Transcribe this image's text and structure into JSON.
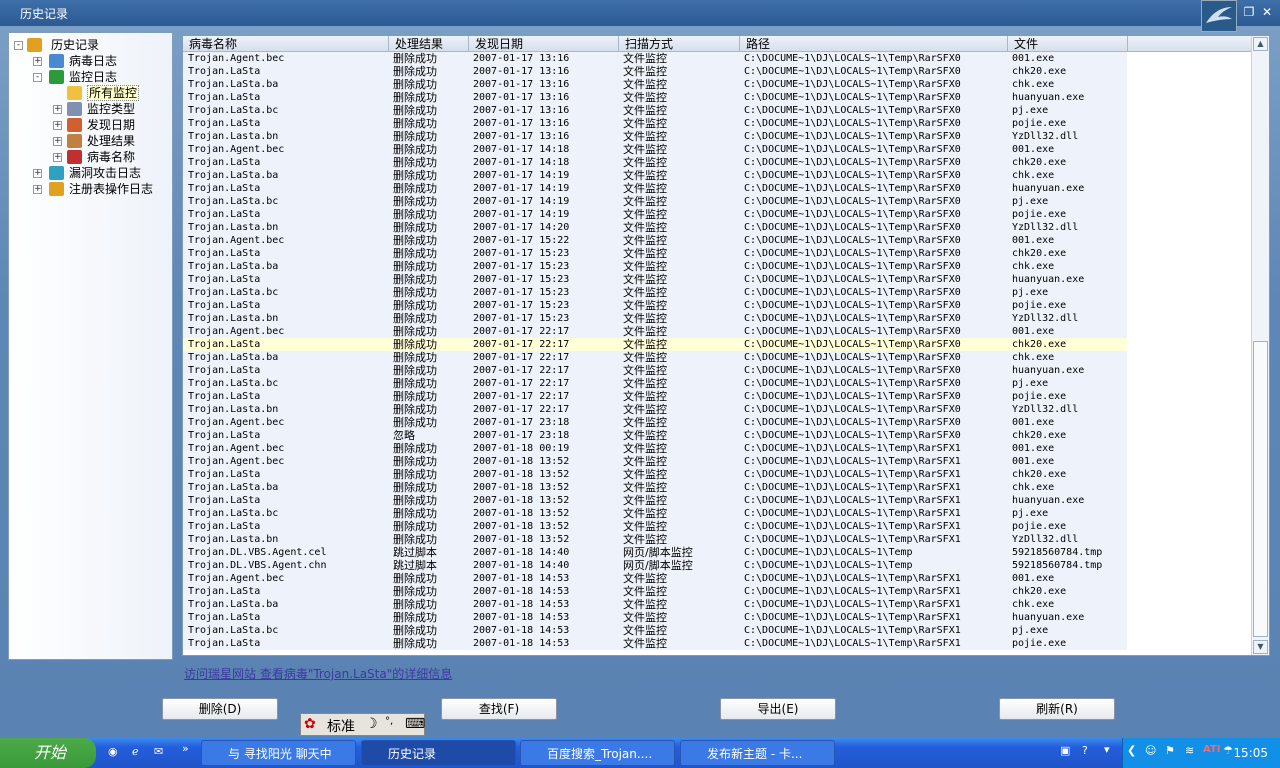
{
  "window": {
    "title": "历史记录"
  },
  "tree": [
    {
      "label": "历史记录",
      "expand": "-",
      "icon": "history-icon"
    },
    {
      "label": "病毒日志",
      "expand": "+",
      "icon": "virus-log-icon"
    },
    {
      "label": "监控日志",
      "expand": "-",
      "icon": "monitor-log-icon"
    },
    {
      "label": "所有监控",
      "expand": "",
      "icon": "all-monitor-icon",
      "selected": true
    },
    {
      "label": "监控类型",
      "expand": "+",
      "icon": "monitor-type-icon"
    },
    {
      "label": "发现日期",
      "expand": "+",
      "icon": "date-icon"
    },
    {
      "label": "处理结果",
      "expand": "+",
      "icon": "result-icon"
    },
    {
      "label": "病毒名称",
      "expand": "+",
      "icon": "virus-name-icon"
    },
    {
      "label": "漏洞攻击日志",
      "expand": "+",
      "icon": "exploit-log-icon"
    },
    {
      "label": "注册表操作日志",
      "expand": "+",
      "icon": "registry-log-icon"
    }
  ],
  "columns": [
    "病毒名称",
    "处理结果",
    "发现日期",
    "扫描方式",
    "路径",
    "文件"
  ],
  "rows": [
    [
      "Trojan.Agent.bec",
      "删除成功",
      "2007-01-17 13:16",
      "文件监控",
      "C:\\DOCUME~1\\DJ\\LOCALS~1\\Temp\\RarSFX0",
      "001.exe"
    ],
    [
      "Trojan.LaSta",
      "删除成功",
      "2007-01-17 13:16",
      "文件监控",
      "C:\\DOCUME~1\\DJ\\LOCALS~1\\Temp\\RarSFX0",
      "chk20.exe"
    ],
    [
      "Trojan.LaSta.ba",
      "删除成功",
      "2007-01-17 13:16",
      "文件监控",
      "C:\\DOCUME~1\\DJ\\LOCALS~1\\Temp\\RarSFX0",
      "chk.exe"
    ],
    [
      "Trojan.LaSta",
      "删除成功",
      "2007-01-17 13:16",
      "文件监控",
      "C:\\DOCUME~1\\DJ\\LOCALS~1\\Temp\\RarSFX0",
      "huanyuan.exe"
    ],
    [
      "Trojan.LaSta.bc",
      "删除成功",
      "2007-01-17 13:16",
      "文件监控",
      "C:\\DOCUME~1\\DJ\\LOCALS~1\\Temp\\RarSFX0",
      "pj.exe"
    ],
    [
      "Trojan.LaSta",
      "删除成功",
      "2007-01-17 13:16",
      "文件监控",
      "C:\\DOCUME~1\\DJ\\LOCALS~1\\Temp\\RarSFX0",
      "pojie.exe"
    ],
    [
      "Trojan.Lasta.bn",
      "删除成功",
      "2007-01-17 13:16",
      "文件监控",
      "C:\\DOCUME~1\\DJ\\LOCALS~1\\Temp\\RarSFX0",
      "YzDll32.dll"
    ],
    [
      "Trojan.Agent.bec",
      "删除成功",
      "2007-01-17 14:18",
      "文件监控",
      "C:\\DOCUME~1\\DJ\\LOCALS~1\\Temp\\RarSFX0",
      "001.exe"
    ],
    [
      "Trojan.LaSta",
      "删除成功",
      "2007-01-17 14:18",
      "文件监控",
      "C:\\DOCUME~1\\DJ\\LOCALS~1\\Temp\\RarSFX0",
      "chk20.exe"
    ],
    [
      "Trojan.LaSta.ba",
      "删除成功",
      "2007-01-17 14:19",
      "文件监控",
      "C:\\DOCUME~1\\DJ\\LOCALS~1\\Temp\\RarSFX0",
      "chk.exe"
    ],
    [
      "Trojan.LaSta",
      "删除成功",
      "2007-01-17 14:19",
      "文件监控",
      "C:\\DOCUME~1\\DJ\\LOCALS~1\\Temp\\RarSFX0",
      "huanyuan.exe"
    ],
    [
      "Trojan.LaSta.bc",
      "删除成功",
      "2007-01-17 14:19",
      "文件监控",
      "C:\\DOCUME~1\\DJ\\LOCALS~1\\Temp\\RarSFX0",
      "pj.exe"
    ],
    [
      "Trojan.LaSta",
      "删除成功",
      "2007-01-17 14:19",
      "文件监控",
      "C:\\DOCUME~1\\DJ\\LOCALS~1\\Temp\\RarSFX0",
      "pojie.exe"
    ],
    [
      "Trojan.Lasta.bn",
      "删除成功",
      "2007-01-17 14:20",
      "文件监控",
      "C:\\DOCUME~1\\DJ\\LOCALS~1\\Temp\\RarSFX0",
      "YzDll32.dll"
    ],
    [
      "Trojan.Agent.bec",
      "删除成功",
      "2007-01-17 15:22",
      "文件监控",
      "C:\\DOCUME~1\\DJ\\LOCALS~1\\Temp\\RarSFX0",
      "001.exe"
    ],
    [
      "Trojan.LaSta",
      "删除成功",
      "2007-01-17 15:23",
      "文件监控",
      "C:\\DOCUME~1\\DJ\\LOCALS~1\\Temp\\RarSFX0",
      "chk20.exe"
    ],
    [
      "Trojan.LaSta.ba",
      "删除成功",
      "2007-01-17 15:23",
      "文件监控",
      "C:\\DOCUME~1\\DJ\\LOCALS~1\\Temp\\RarSFX0",
      "chk.exe"
    ],
    [
      "Trojan.LaSta",
      "删除成功",
      "2007-01-17 15:23",
      "文件监控",
      "C:\\DOCUME~1\\DJ\\LOCALS~1\\Temp\\RarSFX0",
      "huanyuan.exe"
    ],
    [
      "Trojan.LaSta.bc",
      "删除成功",
      "2007-01-17 15:23",
      "文件监控",
      "C:\\DOCUME~1\\DJ\\LOCALS~1\\Temp\\RarSFX0",
      "pj.exe"
    ],
    [
      "Trojan.LaSta",
      "删除成功",
      "2007-01-17 15:23",
      "文件监控",
      "C:\\DOCUME~1\\DJ\\LOCALS~1\\Temp\\RarSFX0",
      "pojie.exe"
    ],
    [
      "Trojan.Lasta.bn",
      "删除成功",
      "2007-01-17 15:23",
      "文件监控",
      "C:\\DOCUME~1\\DJ\\LOCALS~1\\Temp\\RarSFX0",
      "YzDll32.dll"
    ],
    [
      "Trojan.Agent.bec",
      "删除成功",
      "2007-01-17 22:17",
      "文件监控",
      "C:\\DOCUME~1\\DJ\\LOCALS~1\\Temp\\RarSFX0",
      "001.exe"
    ],
    [
      "Trojan.LaSta",
      "删除成功",
      "2007-01-17 22:17",
      "文件监控",
      "C:\\DOCUME~1\\DJ\\LOCALS~1\\Temp\\RarSFX0",
      "chk20.exe"
    ],
    [
      "Trojan.LaSta.ba",
      "删除成功",
      "2007-01-17 22:17",
      "文件监控",
      "C:\\DOCUME~1\\DJ\\LOCALS~1\\Temp\\RarSFX0",
      "chk.exe"
    ],
    [
      "Trojan.LaSta",
      "删除成功",
      "2007-01-17 22:17",
      "文件监控",
      "C:\\DOCUME~1\\DJ\\LOCALS~1\\Temp\\RarSFX0",
      "huanyuan.exe"
    ],
    [
      "Trojan.LaSta.bc",
      "删除成功",
      "2007-01-17 22:17",
      "文件监控",
      "C:\\DOCUME~1\\DJ\\LOCALS~1\\Temp\\RarSFX0",
      "pj.exe"
    ],
    [
      "Trojan.LaSta",
      "删除成功",
      "2007-01-17 22:17",
      "文件监控",
      "C:\\DOCUME~1\\DJ\\LOCALS~1\\Temp\\RarSFX0",
      "pojie.exe"
    ],
    [
      "Trojan.Lasta.bn",
      "删除成功",
      "2007-01-17 22:17",
      "文件监控",
      "C:\\DOCUME~1\\DJ\\LOCALS~1\\Temp\\RarSFX0",
      "YzDll32.dll"
    ],
    [
      "Trojan.Agent.bec",
      "删除成功",
      "2007-01-17 23:18",
      "文件监控",
      "C:\\DOCUME~1\\DJ\\LOCALS~1\\Temp\\RarSFX0",
      "001.exe"
    ],
    [
      "Trojan.LaSta",
      "忽略",
      "2007-01-17 23:18",
      "文件监控",
      "C:\\DOCUME~1\\DJ\\LOCALS~1\\Temp\\RarSFX0",
      "chk20.exe"
    ],
    [
      "Trojan.Agent.bec",
      "删除成功",
      "2007-01-18 00:19",
      "文件监控",
      "C:\\DOCUME~1\\DJ\\LOCALS~1\\Temp\\RarSFX1",
      "001.exe"
    ],
    [
      "Trojan.Agent.bec",
      "删除成功",
      "2007-01-18 13:52",
      "文件监控",
      "C:\\DOCUME~1\\DJ\\LOCALS~1\\Temp\\RarSFX1",
      "001.exe"
    ],
    [
      "Trojan.LaSta",
      "删除成功",
      "2007-01-18 13:52",
      "文件监控",
      "C:\\DOCUME~1\\DJ\\LOCALS~1\\Temp\\RarSFX1",
      "chk20.exe"
    ],
    [
      "Trojan.LaSta.ba",
      "删除成功",
      "2007-01-18 13:52",
      "文件监控",
      "C:\\DOCUME~1\\DJ\\LOCALS~1\\Temp\\RarSFX1",
      "chk.exe"
    ],
    [
      "Trojan.LaSta",
      "删除成功",
      "2007-01-18 13:52",
      "文件监控",
      "C:\\DOCUME~1\\DJ\\LOCALS~1\\Temp\\RarSFX1",
      "huanyuan.exe"
    ],
    [
      "Trojan.LaSta.bc",
      "删除成功",
      "2007-01-18 13:52",
      "文件监控",
      "C:\\DOCUME~1\\DJ\\LOCALS~1\\Temp\\RarSFX1",
      "pj.exe"
    ],
    [
      "Trojan.LaSta",
      "删除成功",
      "2007-01-18 13:52",
      "文件监控",
      "C:\\DOCUME~1\\DJ\\LOCALS~1\\Temp\\RarSFX1",
      "pojie.exe"
    ],
    [
      "Trojan.Lasta.bn",
      "删除成功",
      "2007-01-18 13:52",
      "文件监控",
      "C:\\DOCUME~1\\DJ\\LOCALS~1\\Temp\\RarSFX1",
      "YzDll32.dll"
    ],
    [
      "Trojan.DL.VBS.Agent.cel",
      "跳过脚本",
      "2007-01-18 14:40",
      "网页/脚本监控",
      "C:\\DOCUME~1\\DJ\\LOCALS~1\\Temp",
      "59218560784.tmp"
    ],
    [
      "Trojan.DL.VBS.Agent.chn",
      "跳过脚本",
      "2007-01-18 14:40",
      "网页/脚本监控",
      "C:\\DOCUME~1\\DJ\\LOCALS~1\\Temp",
      "59218560784.tmp"
    ],
    [
      "Trojan.Agent.bec",
      "删除成功",
      "2007-01-18 14:53",
      "文件监控",
      "C:\\DOCUME~1\\DJ\\LOCALS~1\\Temp\\RarSFX1",
      "001.exe"
    ],
    [
      "Trojan.LaSta",
      "删除成功",
      "2007-01-18 14:53",
      "文件监控",
      "C:\\DOCUME~1\\DJ\\LOCALS~1\\Temp\\RarSFX1",
      "chk20.exe"
    ],
    [
      "Trojan.LaSta.ba",
      "删除成功",
      "2007-01-18 14:53",
      "文件监控",
      "C:\\DOCUME~1\\DJ\\LOCALS~1\\Temp\\RarSFX1",
      "chk.exe"
    ],
    [
      "Trojan.LaSta",
      "删除成功",
      "2007-01-18 14:53",
      "文件监控",
      "C:\\DOCUME~1\\DJ\\LOCALS~1\\Temp\\RarSFX1",
      "huanyuan.exe"
    ],
    [
      "Trojan.LaSta.bc",
      "删除成功",
      "2007-01-18 14:53",
      "文件监控",
      "C:\\DOCUME~1\\DJ\\LOCALS~1\\Temp\\RarSFX1",
      "pj.exe"
    ],
    [
      "Trojan.LaSta",
      "删除成功",
      "2007-01-18 14:53",
      "文件监控",
      "C:\\DOCUME~1\\DJ\\LOCALS~1\\Temp\\RarSFX1",
      "pojie.exe"
    ]
  ],
  "selected_row": 22,
  "detail_link": "访问瑞星网站 查看病毒\"Trojan.LaSta\"的详细信息",
  "buttons": {
    "delete": "删除(D)",
    "find": "查找(F)",
    "export": "导出(E)",
    "refresh": "刷新(R)"
  },
  "ime": {
    "mode": "标准"
  },
  "taskbar": {
    "start": "开始",
    "tasks": [
      "与 寻找阳光 聊天中",
      "历史记录",
      "百度搜索_Trojan....",
      "发布新主题 - 卡..."
    ],
    "active_task": 1,
    "clock": "15:05"
  },
  "colors": {
    "row_bg": "#eef3fb",
    "selected_row": "#ffffd8",
    "link": "#3a3aa0",
    "taskbar": "#245edb",
    "start": "#3a9a3a"
  }
}
